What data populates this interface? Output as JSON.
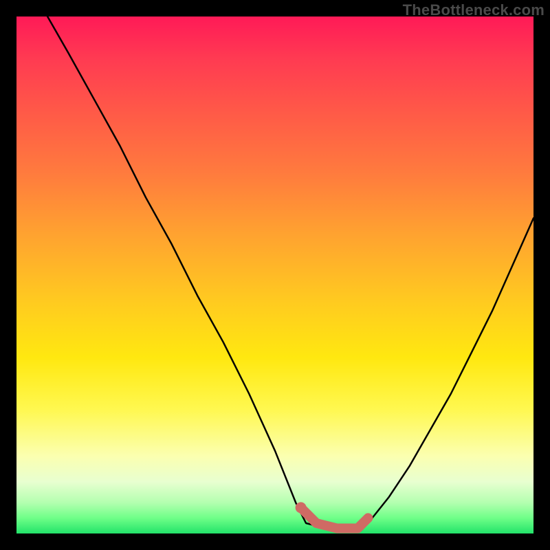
{
  "watermark": "TheBottleneck.com",
  "colors": {
    "curve": "#000000",
    "highlight": "#cf6a64",
    "background_black": "#000000"
  },
  "chart_data": {
    "type": "line",
    "title": "",
    "xlabel": "",
    "ylabel": "",
    "xlim": [
      0,
      100
    ],
    "ylim": [
      0,
      100
    ],
    "grid": false,
    "series": [
      {
        "name": "bottleneck-curve-left",
        "x": [
          6,
          10,
          15,
          20,
          25,
          30,
          35,
          40,
          45,
          50,
          54,
          56
        ],
        "values": [
          100,
          93,
          84,
          75,
          65,
          56,
          46,
          37,
          27,
          16,
          6,
          2
        ]
      },
      {
        "name": "bottleneck-curve-bottom",
        "x": [
          56,
          60,
          64,
          68
        ],
        "values": [
          2,
          1,
          1,
          2
        ]
      },
      {
        "name": "bottleneck-curve-right",
        "x": [
          68,
          72,
          76,
          80,
          84,
          88,
          92,
          96,
          100
        ],
        "values": [
          2,
          7,
          13,
          20,
          27,
          35,
          43,
          52,
          61
        ]
      },
      {
        "name": "highlight-segment",
        "x": [
          55,
          58,
          62,
          66,
          68
        ],
        "values": [
          5,
          2,
          1,
          1,
          3
        ]
      }
    ],
    "annotations": []
  }
}
